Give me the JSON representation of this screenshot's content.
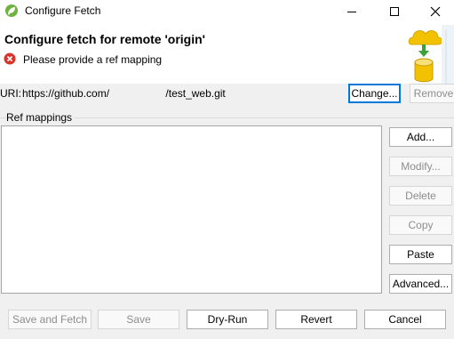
{
  "window": {
    "title": "Configure Fetch",
    "controls": {
      "minimize": "minimize",
      "maximize": "maximize",
      "close": "close"
    }
  },
  "header": {
    "title": "Configure fetch for remote 'origin'",
    "error_message": "Please provide a ref mapping",
    "error_icon": "error-circle-icon",
    "image_icon": "cloud-download-database-icon"
  },
  "uri": {
    "label": "URI:",
    "value": "https://github.com/                   /test_web.git",
    "change_label": "Change...",
    "remove_label": "Remove"
  },
  "ref_mappings": {
    "label": "Ref mappings",
    "items": [],
    "buttons": {
      "add": "Add...",
      "modify": "Modify...",
      "delete": "Delete",
      "copy": "Copy",
      "paste": "Paste",
      "advanced": "Advanced..."
    }
  },
  "footer": {
    "save_and_fetch": "Save and Fetch",
    "save": "Save",
    "dry_run": "Dry-Run",
    "revert": "Revert",
    "cancel": "Cancel"
  },
  "colors": {
    "focus_border": "#0078d7",
    "error_red": "#d9342b",
    "cloud_yellow": "#f2c200",
    "arrow_green": "#3aa335"
  }
}
